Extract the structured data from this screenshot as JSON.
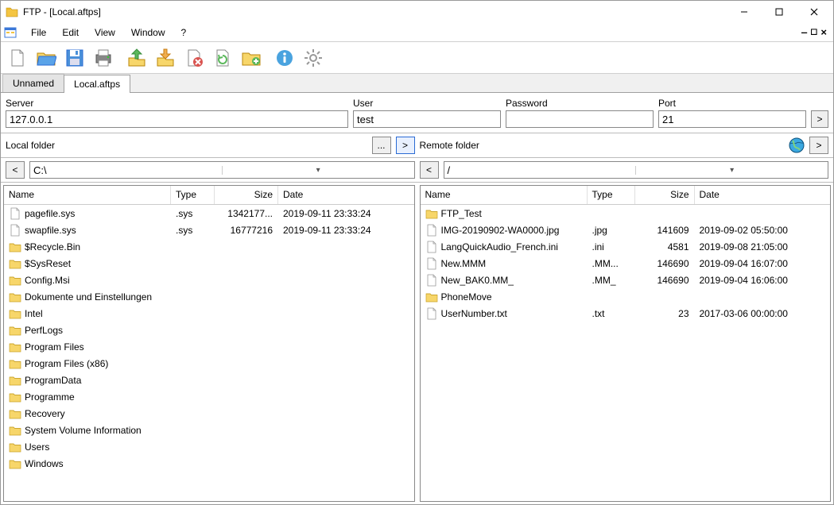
{
  "window": {
    "title": "FTP - [Local.aftps]"
  },
  "menu": {
    "items": [
      "File",
      "Edit",
      "View",
      "Window",
      "?"
    ]
  },
  "tabs": [
    {
      "label": "Unnamed",
      "active": false
    },
    {
      "label": "Local.aftps",
      "active": true
    }
  ],
  "connection": {
    "server": {
      "label": "Server",
      "value": "127.0.0.1"
    },
    "user": {
      "label": "User",
      "value": "test"
    },
    "password": {
      "label": "Password",
      "value": ""
    },
    "port": {
      "label": "Port",
      "value": "21"
    },
    "go": ">"
  },
  "folders": {
    "local_label": "Local folder",
    "remote_label": "Remote folder",
    "browse": "...",
    "transfer": ">",
    "back_left": "<",
    "back_right": "<",
    "go_right": ">",
    "local_path": "C:\\",
    "remote_path": "/"
  },
  "local_columns": {
    "name": "Name",
    "type": "Type",
    "size": "Size",
    "date": "Date"
  },
  "remote_columns": {
    "name": "Name",
    "type": "Type",
    "size": "Size",
    "date": "Date"
  },
  "local_widths": {
    "name": 210,
    "type": 55,
    "size": 80,
    "date": 150
  },
  "remote_widths": {
    "name": 210,
    "type": 60,
    "size": 75,
    "date": 142
  },
  "local_files": [
    {
      "icon": "file",
      "name": "pagefile.sys",
      "type": ".sys",
      "size": "1342177...",
      "date": "2019-09-11 23:33:24"
    },
    {
      "icon": "file",
      "name": "swapfile.sys",
      "type": ".sys",
      "size": "16777216",
      "date": "2019-09-11 23:33:24"
    },
    {
      "icon": "folder",
      "name": "$Recycle.Bin",
      "type": "",
      "size": "",
      "date": ""
    },
    {
      "icon": "folder",
      "name": "$SysReset",
      "type": "",
      "size": "",
      "date": ""
    },
    {
      "icon": "folder",
      "name": "Config.Msi",
      "type": "",
      "size": "",
      "date": ""
    },
    {
      "icon": "folder",
      "name": "Dokumente und Einstellungen",
      "type": "",
      "size": "",
      "date": ""
    },
    {
      "icon": "folder",
      "name": "Intel",
      "type": "",
      "size": "",
      "date": ""
    },
    {
      "icon": "folder",
      "name": "PerfLogs",
      "type": "",
      "size": "",
      "date": ""
    },
    {
      "icon": "folder",
      "name": "Program Files",
      "type": "",
      "size": "",
      "date": ""
    },
    {
      "icon": "folder",
      "name": "Program Files (x86)",
      "type": "",
      "size": "",
      "date": ""
    },
    {
      "icon": "folder",
      "name": "ProgramData",
      "type": "",
      "size": "",
      "date": ""
    },
    {
      "icon": "folder",
      "name": "Programme",
      "type": "",
      "size": "",
      "date": ""
    },
    {
      "icon": "folder",
      "name": "Recovery",
      "type": "",
      "size": "",
      "date": ""
    },
    {
      "icon": "folder",
      "name": "System Volume Information",
      "type": "",
      "size": "",
      "date": ""
    },
    {
      "icon": "folder",
      "name": "Users",
      "type": "",
      "size": "",
      "date": ""
    },
    {
      "icon": "folder",
      "name": "Windows",
      "type": "",
      "size": "",
      "date": ""
    }
  ],
  "remote_files": [
    {
      "icon": "folder",
      "name": "FTP_Test",
      "type": "",
      "size": "",
      "date": ""
    },
    {
      "icon": "file",
      "name": "IMG-20190902-WA0000.jpg",
      "type": ".jpg",
      "size": "141609",
      "date": "2019-09-02 05:50:00"
    },
    {
      "icon": "file",
      "name": "LangQuickAudio_French.ini",
      "type": ".ini",
      "size": "4581",
      "date": "2019-09-08 21:05:00"
    },
    {
      "icon": "file",
      "name": "New.MMM",
      "type": ".MM...",
      "size": "146690",
      "date": "2019-09-04 16:07:00"
    },
    {
      "icon": "file",
      "name": "New_BAK0.MM_",
      "type": ".MM_",
      "size": "146690",
      "date": "2019-09-04 16:06:00"
    },
    {
      "icon": "folder",
      "name": "PhoneMove",
      "type": "",
      "size": "",
      "date": ""
    },
    {
      "icon": "file",
      "name": "UserNumber.txt",
      "type": ".txt",
      "size": "23",
      "date": "2017-03-06 00:00:00"
    }
  ]
}
